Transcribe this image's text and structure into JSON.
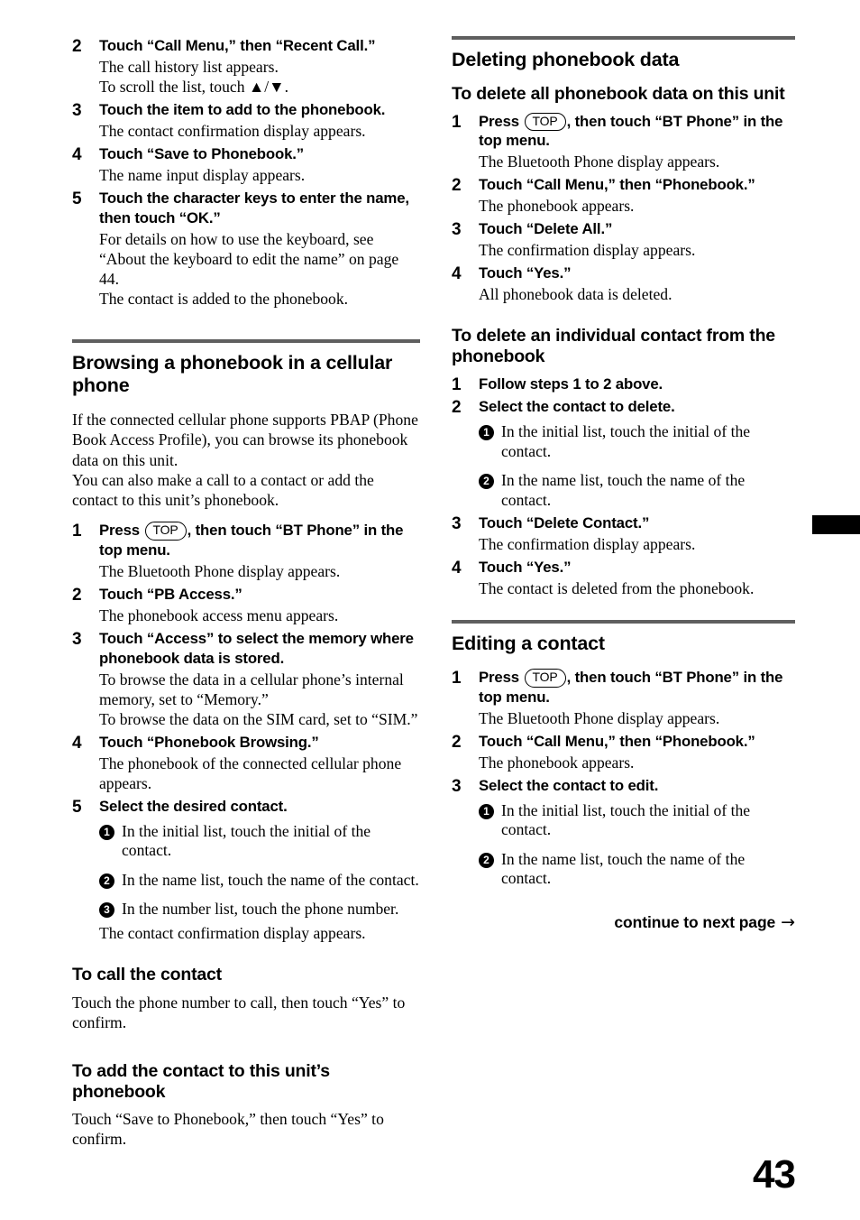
{
  "page": {
    "number": "43",
    "continue_label": "continue to next page",
    "continue_arrow": "→",
    "key_top_label": "TOP"
  },
  "left_column": {
    "steps_continued": [
      {
        "num": "2",
        "title": "Touch “Call Menu,” then “Recent Call.”",
        "body": "The call history list appears.\nTo scroll the list, touch ▲/▼."
      },
      {
        "num": "3",
        "title": "Touch the item to add to the phonebook.",
        "body": "The contact confirmation display appears."
      },
      {
        "num": "4",
        "title": "Touch “Save to Phonebook.”",
        "body": "The name input display appears."
      },
      {
        "num": "5",
        "title": "Touch the character keys to enter the name, then touch “OK.”",
        "body": "For details on how to use the keyboard, see “About the keyboard to edit the name” on page 44.\nThe contact is added to the phonebook."
      }
    ],
    "section": {
      "heading": "Browsing a phonebook in a cellular phone",
      "intro": "If the connected cellular phone supports PBAP (Phone Book Access Profile), you can browse its phonebook data on this unit.\nYou can also make a call to a contact or add the contact to this unit’s phonebook.",
      "steps": [
        {
          "num": "1",
          "title_before_key": "Press ",
          "title_after_key": ", then touch “BT Phone” in the top menu.",
          "body": "The Bluetooth Phone display appears."
        },
        {
          "num": "2",
          "title": "Touch “PB Access.”",
          "body": "The phonebook access menu appears."
        },
        {
          "num": "3",
          "title": "Touch “Access” to select the memory where phonebook data is stored.",
          "body": "To browse the data in a cellular phone’s internal memory, set to “Memory.”\nTo browse the data on the SIM card, set to “SIM.”"
        },
        {
          "num": "4",
          "title": "Touch “Phonebook Browsing.”",
          "body": "The phonebook of the connected cellular phone appears."
        },
        {
          "num": "5",
          "title": "Select the desired contact.",
          "substeps": [
            {
              "marker": "1",
              "text": "In the initial list, touch the initial of the contact."
            },
            {
              "marker": "2",
              "text": "In the name list, touch the name of the contact."
            },
            {
              "marker": "3",
              "text": "In the number list, touch the phone number."
            }
          ],
          "body": "The contact confirmation display appears."
        }
      ],
      "subsections": [
        {
          "heading": "To call the contact",
          "body": "Touch the phone number to call, then touch “Yes” to confirm."
        },
        {
          "heading": "To add the contact to this unit’s phonebook",
          "body": "Touch “Save to Phonebook,” then touch “Yes” to confirm."
        }
      ]
    }
  },
  "right_column": {
    "section": {
      "heading": "Deleting phonebook data",
      "subsections": [
        {
          "heading": "To delete all phonebook data on this unit",
          "steps": [
            {
              "num": "1",
              "title_before_key": "Press ",
              "title_after_key": ", then touch “BT Phone” in the top menu.",
              "body": "The Bluetooth Phone display appears."
            },
            {
              "num": "2",
              "title": "Touch “Call Menu,” then “Phonebook.”",
              "body": "The phonebook appears."
            },
            {
              "num": "3",
              "title": "Touch “Delete All.”",
              "body": "The confirmation display appears."
            },
            {
              "num": "4",
              "title": "Touch “Yes.”",
              "body": "All phonebook data is deleted."
            }
          ]
        },
        {
          "heading": "To delete an individual contact from the phonebook",
          "steps": [
            {
              "num": "1",
              "title": "Follow steps 1 to 2 above."
            },
            {
              "num": "2",
              "title": "Select the contact to delete.",
              "substeps": [
                {
                  "marker": "1",
                  "text": "In the initial list, touch the initial of the contact."
                },
                {
                  "marker": "2",
                  "text": "In the name list, touch the name of the contact."
                }
              ]
            },
            {
              "num": "3",
              "title": "Touch “Delete Contact.”",
              "body": "The confirmation display appears."
            },
            {
              "num": "4",
              "title": "Touch “Yes.”",
              "body": "The contact is deleted from the phonebook."
            }
          ]
        }
      ]
    },
    "section2": {
      "heading": "Editing a contact",
      "steps": [
        {
          "num": "1",
          "title_before_key": "Press ",
          "title_after_key": ", then touch “BT Phone” in the top menu.",
          "body": "The Bluetooth Phone display appears."
        },
        {
          "num": "2",
          "title": "Touch “Call Menu,” then “Phonebook.”",
          "body": "The phonebook appears."
        },
        {
          "num": "3",
          "title": "Select the contact to edit.",
          "substeps": [
            {
              "marker": "1",
              "text": "In the initial list, touch the initial of the contact."
            },
            {
              "marker": "2",
              "text": "In the name list, touch the name of the contact."
            }
          ]
        }
      ]
    }
  }
}
